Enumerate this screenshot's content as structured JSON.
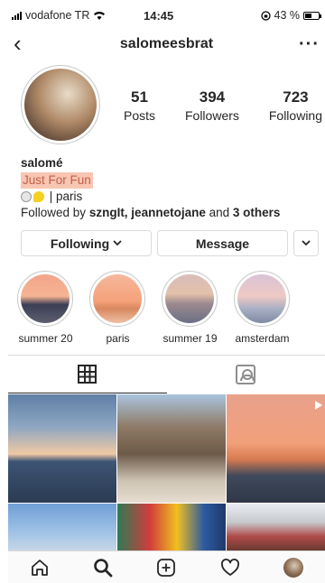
{
  "status": {
    "carrier": "vodafone TR",
    "time": "14:45",
    "battery": "43 %"
  },
  "header": {
    "username": "salomeesbrat"
  },
  "profile": {
    "stats": [
      {
        "value": "51",
        "label": "Posts"
      },
      {
        "value": "394",
        "label": "Followers"
      },
      {
        "value": "723",
        "label": "Following"
      }
    ],
    "name": "salomé",
    "category": "Just For Fun",
    "bio_line": "| paris",
    "followed_by_prefix": "Followed by",
    "followed_by_users": "szngIt, jeannetojane",
    "followed_by_and": "and",
    "followed_by_others": "3 others"
  },
  "actions": {
    "following": "Following",
    "message": "Message"
  },
  "highlights": [
    {
      "label": "summer 20"
    },
    {
      "label": "paris"
    },
    {
      "label": "summer 19"
    },
    {
      "label": "amsterdam"
    }
  ],
  "colors": {
    "category_bg": "#f8c6b3",
    "category_text": "#c0604a"
  }
}
